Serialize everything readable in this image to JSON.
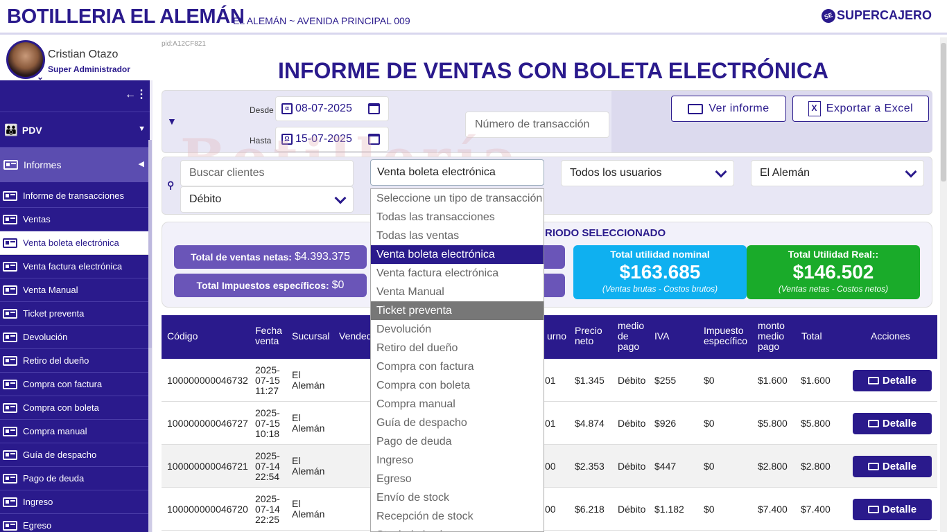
{
  "header": {
    "brand": "BOTILLERIA EL ALEMÁN",
    "subtitle": "EL ALEMÁN ~ AVENIDA PRINCIPAL 009",
    "logo_text": "SUPERCAJERO",
    "logo_mark": "SE"
  },
  "profile": {
    "name": "Cristian Otazo",
    "role": "Super Administrador"
  },
  "sidebar": {
    "collapse_icon": "←⋮",
    "pdv_label": "PDV",
    "informes_label": "Informes",
    "items": [
      {
        "label": "Informe de transacciones"
      },
      {
        "label": "Ventas"
      },
      {
        "label": "Venta boleta electrónica",
        "active": true
      },
      {
        "label": "Venta factura electrónica"
      },
      {
        "label": "Venta Manual"
      },
      {
        "label": "Ticket preventa"
      },
      {
        "label": "Devolución"
      },
      {
        "label": "Retiro del dueño"
      },
      {
        "label": "Compra con factura"
      },
      {
        "label": "Compra con boleta"
      },
      {
        "label": "Compra manual"
      },
      {
        "label": "Guía de despacho"
      },
      {
        "label": "Pago de deuda"
      },
      {
        "label": "Ingreso"
      },
      {
        "label": "Egreso"
      }
    ]
  },
  "pid": "pid:A12CF821",
  "page_title": "INFORME DE VENTAS CON BOLETA ELECTRÓNICA",
  "watermark": "Botillería",
  "filters": {
    "desde_label": "Desde",
    "hasta_label": "Hasta",
    "desde_value": "08-07-2025",
    "hasta_value": "15-07-2025",
    "desde_icon": "α",
    "hasta_icon": "Ω",
    "transaction_placeholder": "Número de transacción",
    "ver_informe": "Ver informe",
    "exportar_excel": "Exportar a Excel",
    "excel_icon": "X",
    "buscar_clientes_placeholder": "Buscar clientes",
    "transaction_type": "Venta boleta electrónica",
    "users": "Todos los usuarios",
    "branch": "El Alemán",
    "payment": "Débito"
  },
  "dropdown_options": [
    {
      "label": "Seleccione un tipo de transacción"
    },
    {
      "label": "Todas las transacciones"
    },
    {
      "label": "Todas las ventas"
    },
    {
      "label": "Venta boleta electrónica",
      "selected": true
    },
    {
      "label": "Venta factura electrónica"
    },
    {
      "label": "Venta Manual"
    },
    {
      "label": "Ticket preventa",
      "hovered": true
    },
    {
      "label": "Devolución"
    },
    {
      "label": "Retiro del dueño"
    },
    {
      "label": "Compra con factura"
    },
    {
      "label": "Compra con boleta"
    },
    {
      "label": "Compra manual"
    },
    {
      "label": "Guía de despacho"
    },
    {
      "label": "Pago de deuda"
    },
    {
      "label": "Ingreso"
    },
    {
      "label": "Egreso"
    },
    {
      "label": "Envío de stock"
    },
    {
      "label": "Recepción de stock"
    },
    {
      "label": "Stock de los bares"
    }
  ],
  "summary": {
    "title_visible": "RIODO SELECCIONADO",
    "ventas_netas_label": "Total de ventas netas:",
    "ventas_netas_value": "$4.393.375",
    "impuestos_label": "Total Impuestos específicos:",
    "impuestos_value": "$0",
    "utilidad_nominal_title": "Total utilidad nominal",
    "utilidad_nominal_value": "$163.685",
    "utilidad_nominal_sub": "(Ventas brutas - Costos brutos)",
    "utilidad_real_title": "Total Utilidad Real::",
    "utilidad_real_value": "$146.502",
    "utilidad_real_sub": "(Ventas netas - Costos netos)",
    "nominal_color": "#0fb0f0",
    "real_color": "#1aab2a"
  },
  "table": {
    "headers": {
      "codigo": "Código",
      "fecha": "Fecha venta",
      "sucursal": "Sucursal",
      "vendedor": "Vendedor",
      "turno": "urno",
      "precio": "Precio neto",
      "medio": "medio de pago",
      "iva": "IVA",
      "impuesto": "Impuesto específico",
      "monto": "monto medio pago",
      "total": "Total",
      "acciones": "Acciones"
    },
    "rows": [
      {
        "codigo": "100000000046732",
        "fecha": "2025-07-15 11:27",
        "sucursal": "El Alemán",
        "turno": "01",
        "precio": "$1.345",
        "medio": "Débito",
        "iva": "$255",
        "impuesto": "$0",
        "monto": "$1.600",
        "total": "$1.600"
      },
      {
        "codigo": "100000000046727",
        "fecha": "2025-07-15 10:18",
        "sucursal": "El Alemán",
        "turno": "01",
        "precio": "$4.874",
        "medio": "Débito",
        "iva": "$926",
        "impuesto": "$0",
        "monto": "$5.800",
        "total": "$5.800"
      },
      {
        "codigo": "100000000046721",
        "fecha": "2025-07-14 22:54",
        "sucursal": "El Alemán",
        "turno": "00",
        "precio": "$2.353",
        "medio": "Débito",
        "iva": "$447",
        "impuesto": "$0",
        "monto": "$2.800",
        "total": "$2.800"
      },
      {
        "codigo": "100000000046720",
        "fecha": "2025-07-14 22:25",
        "sucursal": "El Alemán",
        "turno": "00",
        "precio": "$6.218",
        "medio": "Débito",
        "iva": "$1.182",
        "impuesto": "$0",
        "monto": "$7.400",
        "total": "$7.400"
      }
    ],
    "detail_label": "Detalle"
  }
}
